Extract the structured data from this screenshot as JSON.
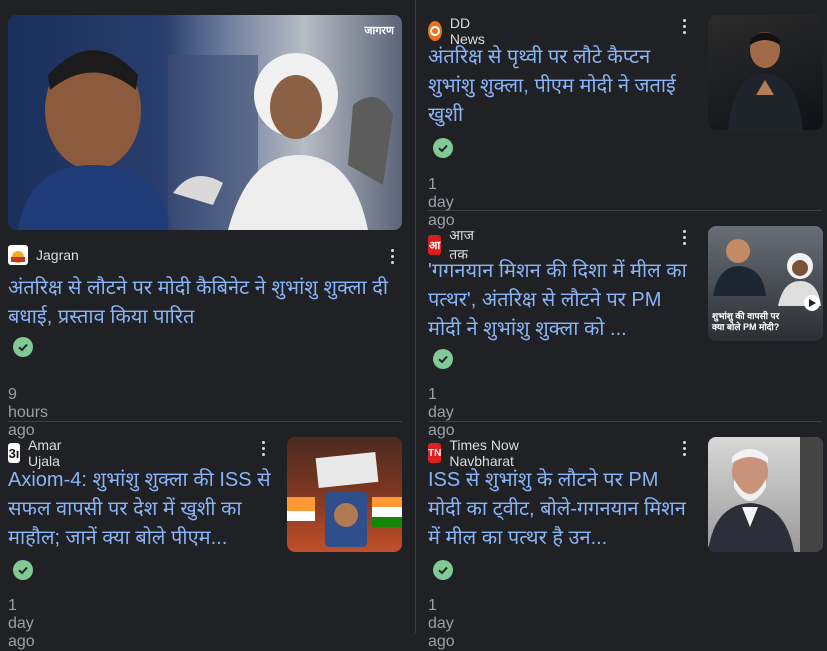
{
  "colors": {
    "background": "#202124",
    "headline": "#8ab4f8",
    "timestamp": "#9aa0a6",
    "source": "#dadce0",
    "verified": "#81c995"
  },
  "cards": [
    {
      "source": "Jagran",
      "headline": "अंतरिक्ष से लौटने पर मोदी कैबिनेट ने शुभांशु शुक्ला दी बधाई, प्रस्ताव किया पारित",
      "time": "9 hours ago",
      "image_watermark": "जागरण"
    },
    {
      "source": "DD News",
      "headline": "अंतरिक्ष से पृथ्वी पर लौटे कैप्टन शुभांशु शुक्ला, पीएम मोदी ने जताई खुशी",
      "time": "1 day ago"
    },
    {
      "source": "आज तक",
      "headline": "'गगनयान मिशन की दिशा में मील का पत्थर', अंतरिक्ष से लौटने पर PM मोदी ने शुभांशु शुक्ला को ...",
      "time": "1 day ago",
      "image_caption": "शुभांशु की वापसी पर क्या बोले PM मोदी?"
    },
    {
      "source": "Amar Ujala",
      "headline": "Axiom-4: शुभांशु शुक्ला की ISS से सफल वापसी पर देश में खुशी का माहौल; जानें क्या बोले पीएम...",
      "time": "1 day ago"
    },
    {
      "source": "Times Now Navbharat",
      "headline": "ISS से शुभांशु के लौटने पर PM मोदी का ट्वीट, बोले-गगनयान मिशन में मील का पत्थर है उन...",
      "time": "1 day ago"
    }
  ]
}
